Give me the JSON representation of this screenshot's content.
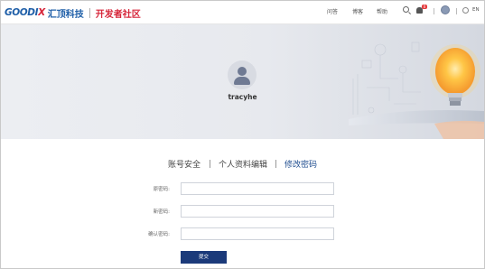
{
  "header": {
    "logo_mark_a": "GOODI",
    "logo_mark_x": "X",
    "logo_cn": "汇顶科技",
    "logo_dev": "开发者社区",
    "nav": [
      "问答",
      "博客",
      "帮助"
    ],
    "notification_count": "0",
    "language": "EN"
  },
  "profile": {
    "username": "tracyhe"
  },
  "tabs": [
    {
      "label": "账号安全",
      "active": false
    },
    {
      "label": "个人资料编辑",
      "active": false
    },
    {
      "label": "修改密码",
      "active": true
    }
  ],
  "form": {
    "old_password_label": "原密码:",
    "new_password_label": "新密码:",
    "confirm_password_label": "确认密码:",
    "submit_label": "提交"
  },
  "colors": {
    "brand_blue": "#1f5fa8",
    "brand_red": "#d6263a",
    "active_tab": "#1f4d8f",
    "submit_bg": "#1b3a7a"
  }
}
